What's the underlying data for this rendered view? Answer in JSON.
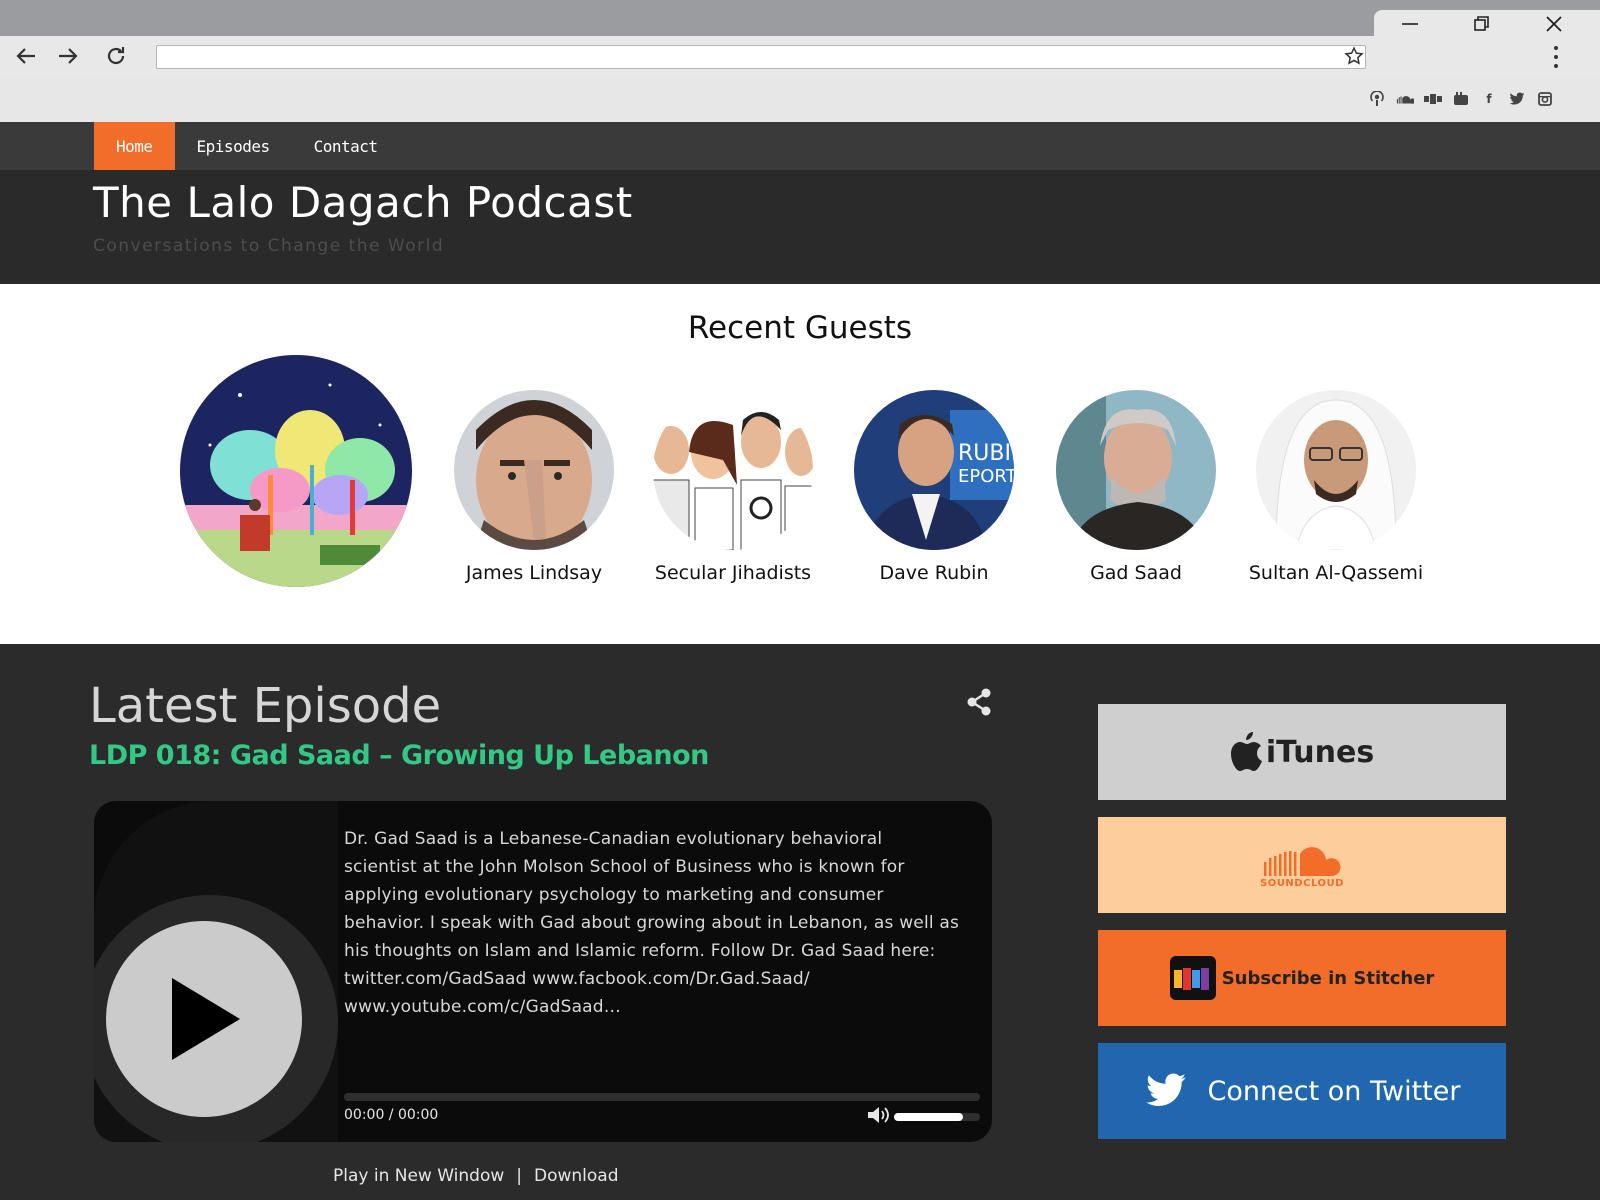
{
  "browser": {
    "address_value": "",
    "address_placeholder": "",
    "window_controls": [
      "minimize-icon",
      "restore-icon",
      "close-icon"
    ]
  },
  "social_icons": [
    "podcast-icon",
    "soundcloud-icon",
    "stitcher-icon",
    "youtube-icon",
    "facebook-icon",
    "twitter-icon",
    "instagram-icon"
  ],
  "nav": {
    "items": [
      {
        "label": "Home",
        "active": true
      },
      {
        "label": "Episodes",
        "active": false
      },
      {
        "label": "Contact",
        "active": false
      }
    ]
  },
  "header": {
    "title": "The Lalo Dagach Podcast",
    "tagline": "Conversations to Change the World"
  },
  "guests": {
    "title": "Recent Guests",
    "list": [
      {
        "name": "James Lindsay"
      },
      {
        "name": "Secular Jihadists"
      },
      {
        "name": "Dave Rubin"
      },
      {
        "name": "Gad Saad"
      },
      {
        "name": "Sultan Al-Qassemi"
      }
    ]
  },
  "latest": {
    "heading": "Latest Episode",
    "episode_title": "LDP 018: Gad Saad – Growing Up Lebanon",
    "description": "Dr. Gad Saad is a Lebanese-Canadian evolutionary behavioral scientist at the John Molson School of Business who is known for applying evolutionary psychology to marketing and consumer behavior. I speak with Gad about growing about in Lebanon, as well as his thoughts on Islam and Islamic reform. Follow Dr. Gad Saad here: twitter.com/GadSaad www.facbook.com/Dr.Gad.Saad/ www.youtube.com/c/GadSaad…",
    "time": "00:00 / 00:00",
    "progress": 0,
    "volume": 0.8,
    "play_new_window": "Play in New Window",
    "separator": "|",
    "download": "Download"
  },
  "subscribe": {
    "itunes": "iTunes",
    "soundcloud": "SOUNDCLOUD",
    "stitcher": "Subscribe in Stitcher",
    "twitter": "Connect on Twitter"
  },
  "colors": {
    "accent": "#f36d2a",
    "episode_title": "#34c886",
    "twitter": "#2167b0",
    "soundcloud_bg": "#fdce9b",
    "itunes_bg": "#cfcfcf"
  }
}
